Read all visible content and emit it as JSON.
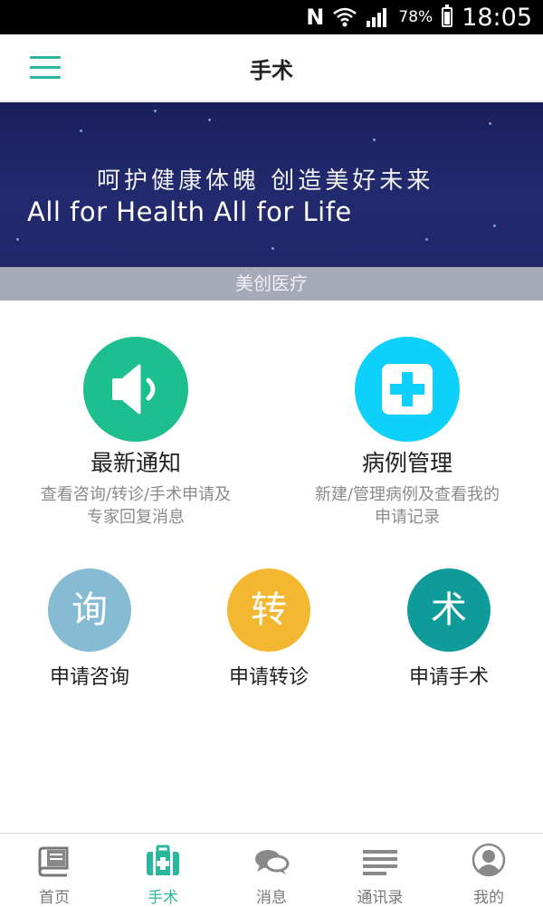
{
  "status_bar": {
    "carrier_icon": "N",
    "battery_percent": "78%",
    "time": "18:05",
    "battery_level": 0.78
  },
  "header": {
    "title": "手术",
    "menu_icon": "hamburger-menu-icon"
  },
  "banner": {
    "slogan_cn": "呵护健康体魄  创造美好未来",
    "slogan_en": "All for Health All for Life",
    "caption": "美创医疗"
  },
  "features": [
    {
      "title": "最新通知",
      "description_line1": "查看咨询/转诊/手术申请及",
      "description_line2": "专家回复消息",
      "icon": "speaker-icon",
      "color": "#1dbf8f"
    },
    {
      "title": "病例管理",
      "description_line1": "新建/管理病例及查看我的",
      "description_line2": "申请记录",
      "icon": "medical-plus-icon",
      "color": "#0ed1fb"
    }
  ],
  "actions": [
    {
      "glyph": "询",
      "label": "申请咨询",
      "color": "#86bcd3"
    },
    {
      "glyph": "转",
      "label": "申请转诊",
      "color": "#f4b731"
    },
    {
      "glyph": "术",
      "label": "申请手术",
      "color": "#109b9b"
    }
  ],
  "bottom_nav": [
    {
      "label": "首页",
      "icon": "book-icon",
      "active": false
    },
    {
      "label": "手术",
      "icon": "medical-kit-icon",
      "active": true
    },
    {
      "label": "消息",
      "icon": "chat-bubble-icon",
      "active": false
    },
    {
      "label": "通讯录",
      "icon": "list-icon",
      "active": false
    },
    {
      "label": "我的",
      "icon": "user-avatar-icon",
      "active": false
    }
  ],
  "colors": {
    "accent": "#2bb79c",
    "inactive": "#777777"
  }
}
